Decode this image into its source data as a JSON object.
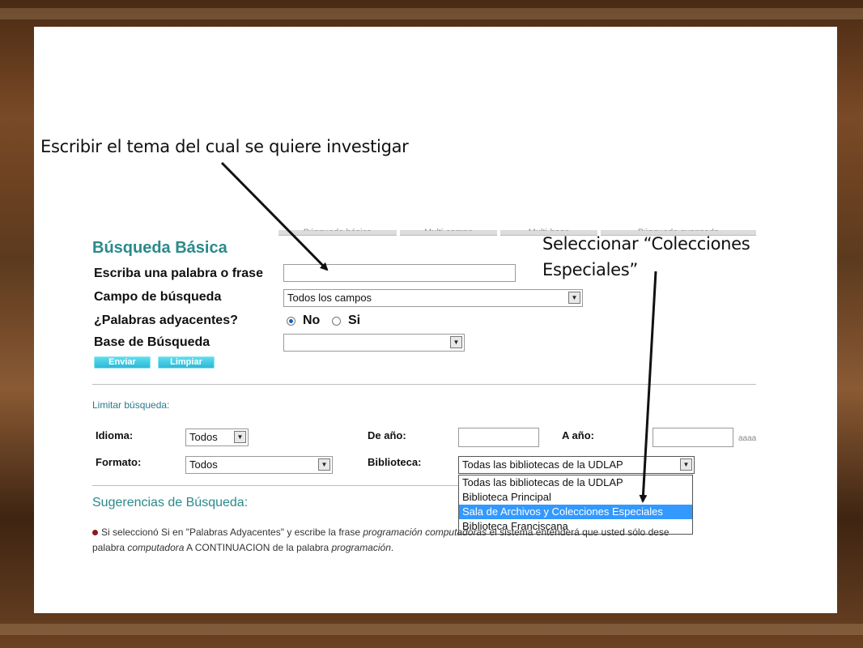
{
  "annotations": {
    "topic_note": "Escribir el tema del cual se quiere investigar",
    "select_note_line1": "Seleccionar “Colecciones",
    "select_note_line2": "Especiales”"
  },
  "tabs": [
    "Búsqueda básica",
    "Multi-campo",
    "Multi-base",
    "Búsqueda avanzada"
  ],
  "basic_search": {
    "title": "Búsqueda Básica",
    "phrase_label": "Escriba una palabra o frase",
    "phrase_value": "",
    "field_label": "Campo de búsqueda",
    "field_value": "Todos los campos",
    "adjacent_label": "¿Palabras adyacentes?",
    "adjacent_no": "No",
    "adjacent_si": "Si",
    "adjacent_selected": "No",
    "base_label": "Base de Búsqueda",
    "base_value": "",
    "send_button": "Enviar",
    "clear_button": "Limpiar"
  },
  "limit": {
    "title": "Limitar búsqueda:",
    "language_label": "Idioma:",
    "language_value": "Todos",
    "from_year_label": "De año:",
    "to_year_label": "A año:",
    "year_hint": "aaaa",
    "format_label": "Formato:",
    "format_value": "Todos",
    "library_label": "Biblioteca:",
    "library_value": "Todas las bibliotecas de la UDLAP",
    "library_options": [
      "Todas las bibliotecas de la UDLAP",
      "Biblioteca Principal",
      "Sala de Archivos y Colecciones Especiales",
      "Biblioteca Franciscana"
    ],
    "highlighted_option": "Sala de Archivos y Colecciones Especiales"
  },
  "suggestions": {
    "title": "Sugerencias de Búsqueda:",
    "text_part1": "Si seleccionó Si en \"Palabras Adyacentes\" y escribe la frase ",
    "text_em1": "programación computadoras",
    "text_part2": " el sistema entenderá que usted sólo dese",
    "text_line2_a": "palabra ",
    "text_em2": "computadora",
    "text_line2_b": "  A CONTINUACION de la palabra ",
    "text_em3": "programación",
    "text_line2_c": "."
  },
  "colors": {
    "accent_teal": "#2a8a8a",
    "button_cyan": "#2cb4d4",
    "highlight_blue": "#3399ff"
  }
}
